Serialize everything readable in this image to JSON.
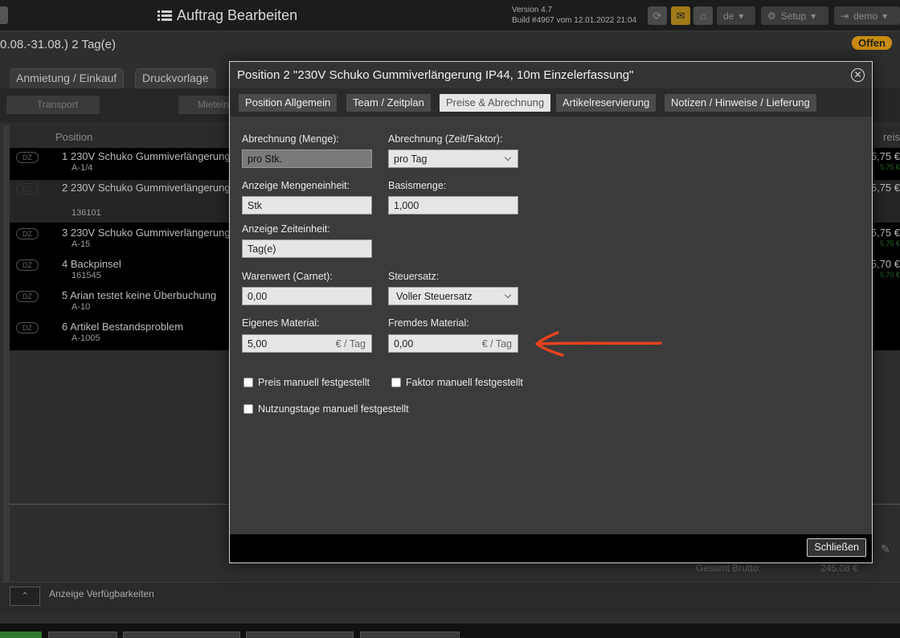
{
  "header": {
    "title": "Auftrag Bearbeiten",
    "version": "Version 4.7",
    "build": "Build #4967 vom 12.01.2022 21:04",
    "language": "de",
    "setup_label": "Setup",
    "user_label": "demo"
  },
  "order": {
    "period": "0.08.-31.08.) 2 Tag(e)",
    "status": "Offen"
  },
  "background_tabs": [
    "Anmietung / Einkauf",
    "Druckvorlage"
  ],
  "background_toolbar": [
    "Transport",
    "Mietein"
  ],
  "table": {
    "column_position": "Position",
    "column_price": "reis",
    "rows": [
      {
        "dz": "DZ",
        "name": "1 230V Schuko Gummiverlängerung",
        "sub": "A-1/4",
        "price": "5,75 €",
        "price2": "5,75 €"
      },
      {
        "dz": "DZ",
        "name": "2 230V Schuko Gummiverlängerung",
        "sub": "136101",
        "price": "5,75 €",
        "price2": ""
      },
      {
        "dz": "DZ",
        "name": "3 230V Schuko Gummiverlängerung",
        "sub": "A-15",
        "price": "5,75 €",
        "price2": "5,75 €"
      },
      {
        "dz": "DZ",
        "name": "4 Backpinsel",
        "sub": "161545",
        "price": "5,70 €",
        "price2": "5,70 €"
      },
      {
        "dz": "DZ",
        "name": "5 Arian testet keine Überbuchung",
        "sub": "A-10",
        "price": "",
        "price2": ""
      },
      {
        "dz": "DZ",
        "name": "6 Artikel Bestandsproblem",
        "sub": "A-1005",
        "price": "",
        "price2": ""
      }
    ],
    "gesamt_label": "Gesamt Brutto:",
    "gesamt_value": "245.08 €"
  },
  "availability_label": "Anzeige Verfügbarkeiten",
  "modal": {
    "title": "Position 2 \"230V Schuko Gummiverlängerung IP44, 10m Einzelerfassung\"",
    "tabs": [
      "Position Allgemein",
      "Team / Zeitplan",
      "Preise & Abrechnung",
      "Artikelreservierung",
      "Notizen / Hinweise / Lieferung"
    ],
    "active_tab": "Preise & Abrechnung",
    "fields": {
      "abrechnung_menge_label": "Abrechnung (Menge):",
      "abrechnung_menge_value": "pro Stk.",
      "abrechnung_zeit_label": "Abrechnung (Zeit/Faktor):",
      "abrechnung_zeit_value": "pro Tag",
      "mengeneinheit_label": "Anzeige Mengeneinheit:",
      "mengeneinheit_value": "Stk",
      "basismenge_label": "Basismenge:",
      "basismenge_value": "1,000",
      "zeiteinheit_label": "Anzeige Zeiteinheit:",
      "zeiteinheit_value": "Tag(e)",
      "warenwert_label": "Warenwert (Carnet):",
      "warenwert_value": "0,00",
      "steuersatz_label": "Steuersatz:",
      "steuersatz_value": "Voller Steuersatz",
      "eigenes_label": "Eigenes Material:",
      "eigenes_value": "5,00",
      "eigenes_unit": "€ / Tag",
      "fremdes_label": "Fremdes Material:",
      "fremdes_value": "0,00",
      "fremdes_unit": "€ / Tag"
    },
    "checkboxes": {
      "preis_manuell": "Preis manuell festgestellt",
      "faktor_manuell": "Faktor manuell festgestellt",
      "nutzungstage_manuell": "Nutzungstage manuell festgestellt"
    },
    "close_label": "Schließen"
  },
  "colors": {
    "accent_orange": "#c98c10",
    "annotation_arrow": "#e8421f",
    "active_tab_bg": "#e6e6e6"
  }
}
